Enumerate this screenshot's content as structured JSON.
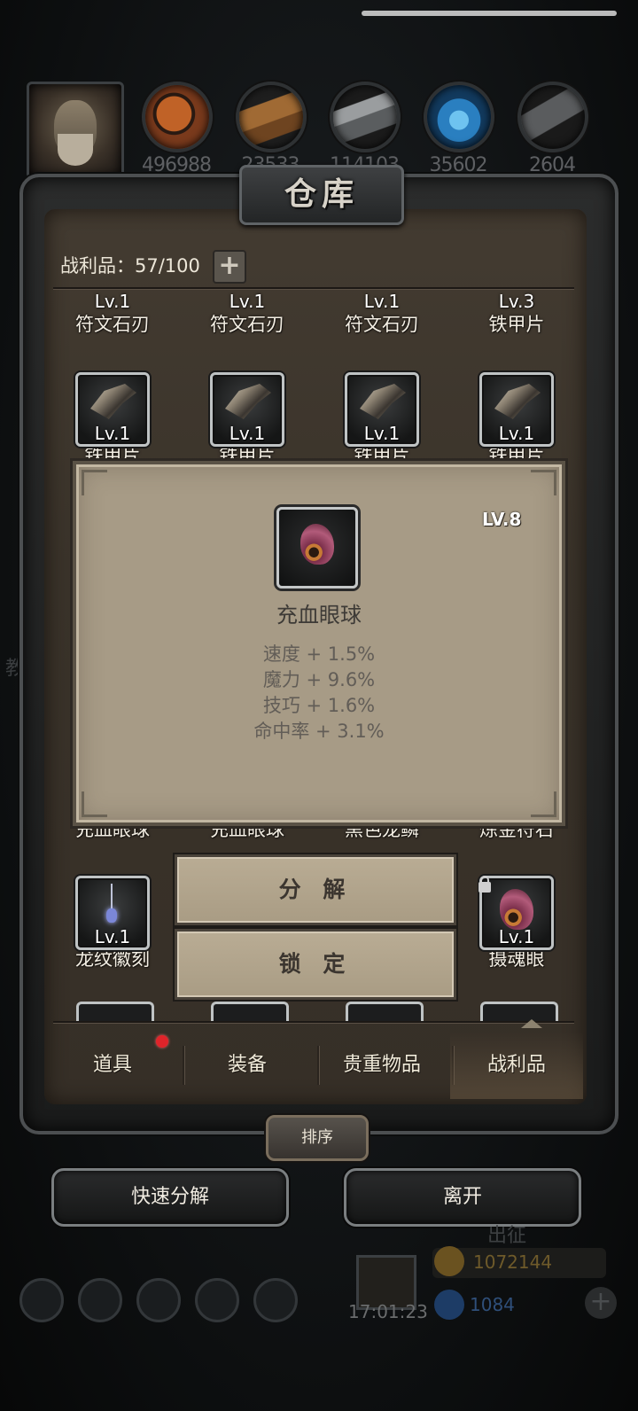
{
  "resources": [
    {
      "icon": "leather-icon",
      "value": "496988",
      "color": "#a5531f"
    },
    {
      "icon": "wood-icon",
      "value": "23533",
      "color": "#8a5a2b"
    },
    {
      "icon": "iron-icon",
      "value": "114103",
      "color": "#777a7c"
    },
    {
      "icon": "crystal-icon",
      "value": "35602",
      "color": "#2f7fb8"
    },
    {
      "icon": "ore-icon",
      "value": "2604",
      "color": "#4a4c4e"
    }
  ],
  "warehouse": {
    "title": "仓库",
    "capacity_label": "战利品：57/100",
    "expand_symbol": "+"
  },
  "rows": {
    "row0": [
      {
        "level": "Lv.1",
        "name": "符文石刃"
      },
      {
        "level": "Lv.1",
        "name": "符文石刃"
      },
      {
        "level": "Lv.1",
        "name": "符文石刃"
      },
      {
        "level": "Lv.3",
        "name": "铁甲片"
      }
    ],
    "row1": [
      {
        "level": "Lv.1",
        "name": "铁甲片"
      },
      {
        "level": "Lv.1",
        "name": "铁甲片"
      },
      {
        "level": "Lv.1",
        "name": "铁甲片"
      },
      {
        "level": "Lv.1",
        "name": "铁甲片"
      }
    ],
    "row3": [
      {
        "name": "充血眼球"
      },
      {
        "name": "充血眼球"
      },
      {
        "name": "黑色龙鳞"
      },
      {
        "name": "炼金符石"
      }
    ],
    "row4": [
      {
        "level": "Lv.1",
        "name": "龙纹徽刻"
      },
      {
        "level": "Lv.1",
        "name": "摄魂眼",
        "locked": true
      }
    ]
  },
  "tooltip": {
    "level": "LV.8",
    "name": "充血眼球",
    "stats": [
      "速度 + 1.5%",
      "魔力 + 9.6%",
      "技巧 + 1.6%",
      "命中率 + 3.1%"
    ]
  },
  "actions": {
    "decompose": "分 解",
    "lock": "锁 定"
  },
  "tabs": [
    "道具",
    "装备",
    "贵重物品",
    "战利品"
  ],
  "active_tab": "战利品",
  "sort_label": "排序",
  "buttons": {
    "quick_decompose": "快速分解",
    "leave": "离开"
  },
  "hud": {
    "expedition": "出征",
    "time": "17:01:23",
    "gold": "1072144",
    "gems": "1084",
    "side_text": "教"
  },
  "colors": {
    "panel": "#3a332a",
    "tooltip_bg": "#a79b86",
    "notification": "#e0242a"
  }
}
